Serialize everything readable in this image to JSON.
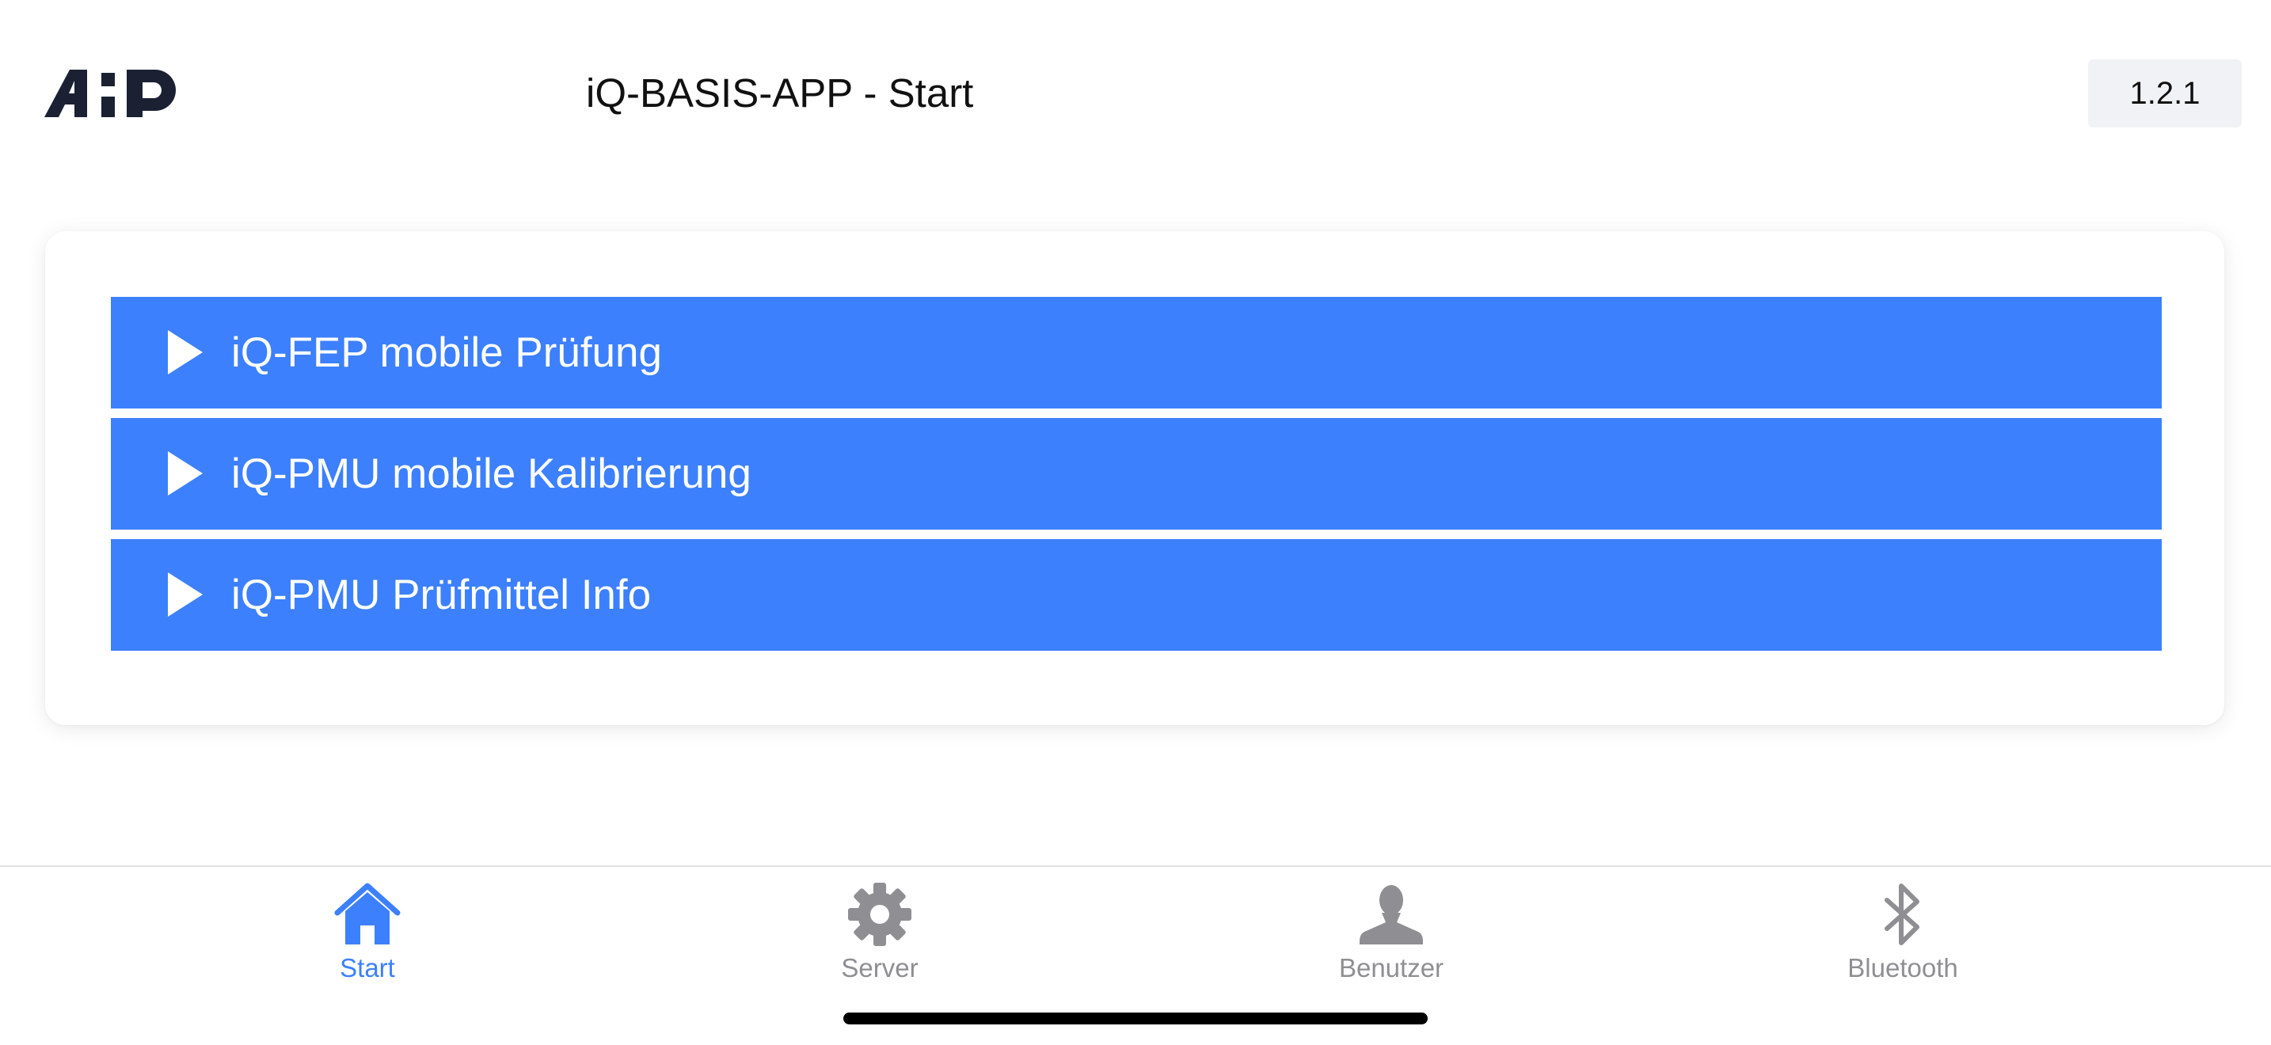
{
  "header": {
    "logo_text": "A:P",
    "title": "iQ-BASIS-APP - Start",
    "version": "1.2.1"
  },
  "menu": {
    "items": [
      {
        "label": "iQ-FEP mobile Prüfung",
        "icon": "play-icon"
      },
      {
        "label": "iQ-PMU mobile Kalibrierung",
        "icon": "play-icon"
      },
      {
        "label": "iQ-PMU Prüfmittel Info",
        "icon": "play-icon"
      }
    ],
    "item_color": "#3d80fd"
  },
  "tabbar": {
    "active": "Start",
    "accent_color": "#3d80fd",
    "inactive_color": "#8e8e93",
    "tabs": [
      {
        "label": "Start",
        "icon": "home-icon"
      },
      {
        "label": "Server",
        "icon": "gear-icon"
      },
      {
        "label": "Benutzer",
        "icon": "user-icon"
      },
      {
        "label": "Bluetooth",
        "icon": "bluetooth-icon"
      }
    ]
  }
}
